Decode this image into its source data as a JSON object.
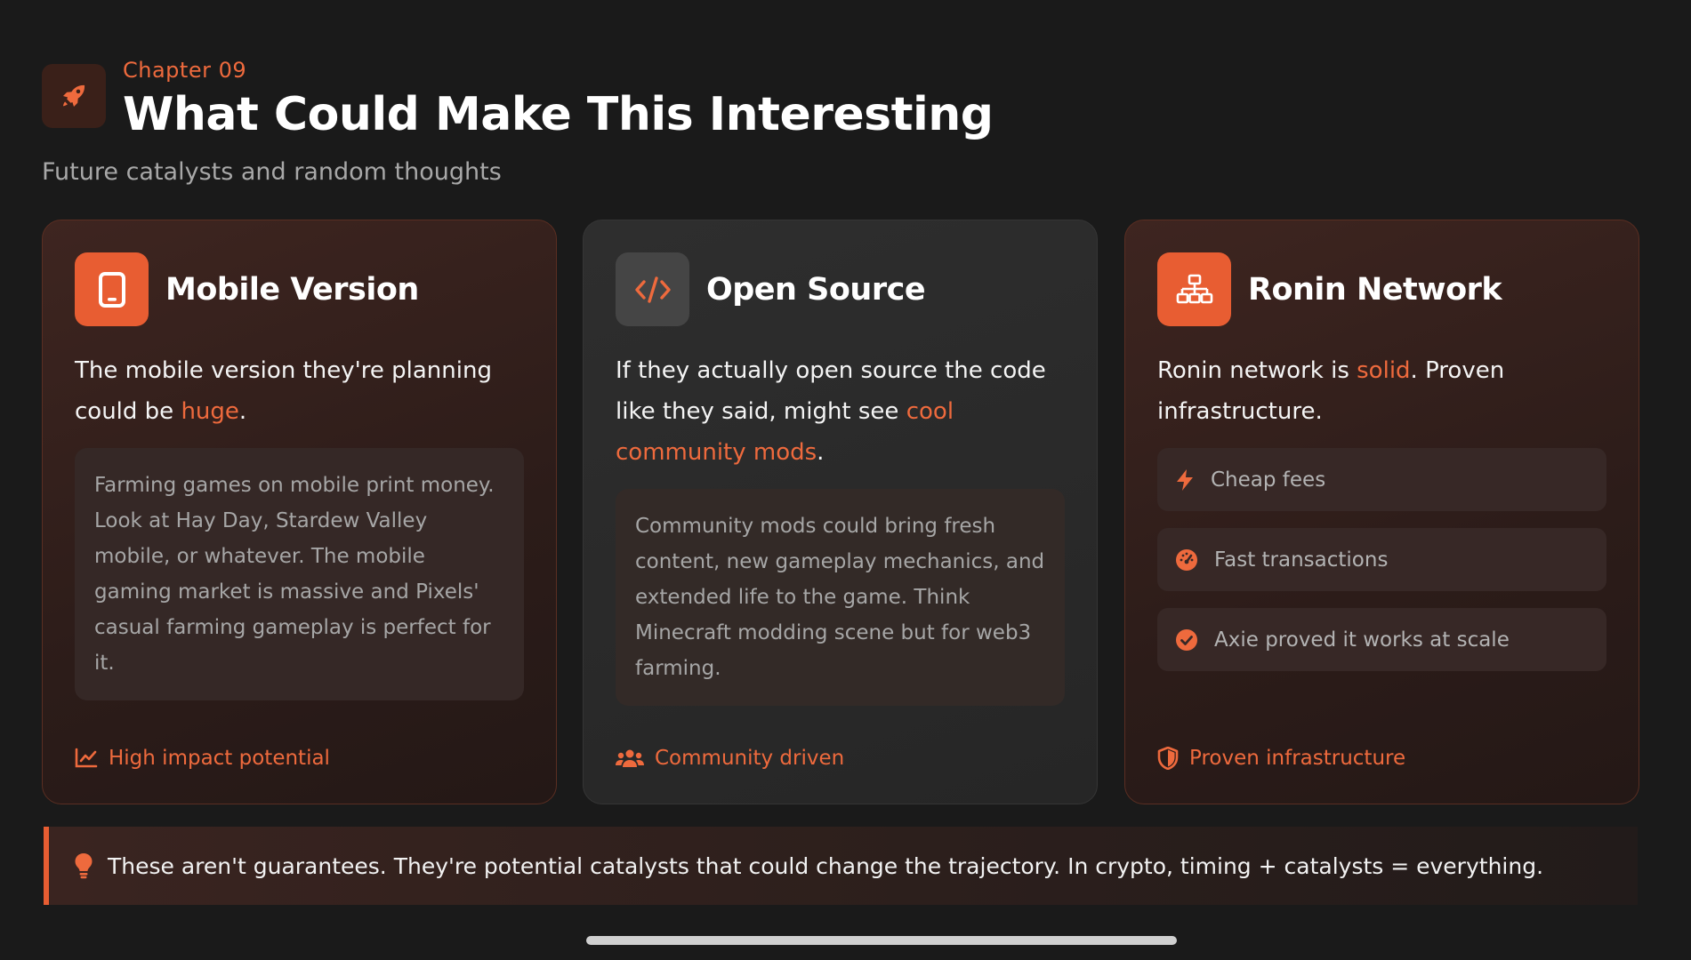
{
  "header": {
    "chapter": "Chapter 09",
    "title": "What Could Make This Interesting",
    "subtitle": "Future catalysts and random thoughts",
    "icon": "rocket-icon"
  },
  "colors": {
    "accent": "#e85d32",
    "accent_text": "#ee6a3d",
    "background": "#1a1a1a"
  },
  "cards": [
    {
      "title": "Mobile Version",
      "icon": "mobile-icon",
      "lead_before": "The mobile version they're planning could be ",
      "lead_highlight": "huge",
      "lead_after": ".",
      "note": "Farming games on mobile print money. Look at Hay Day, Stardew Valley mobile, or whatever. The mobile gaming market is massive and Pixels' casual farming gameplay is perfect for it.",
      "footer": "High impact potential",
      "footer_icon": "chart-line-icon"
    },
    {
      "title": "Open Source",
      "icon": "code-icon",
      "lead_before": "If they actually open source the code like they said, might see ",
      "lead_highlight": "cool community mods",
      "lead_after": ".",
      "note": "Community mods could bring fresh content, new gameplay mechanics, and extended life to the game. Think Minecraft modding scene but for web3 farming.",
      "footer": "Community driven",
      "footer_icon": "users-icon"
    },
    {
      "title": "Ronin Network",
      "icon": "network-icon",
      "lead_before": "Ronin network is ",
      "lead_highlight": "solid",
      "lead_after": ". Proven infrastructure.",
      "features": [
        {
          "label": "Cheap fees",
          "icon": "bolt-icon"
        },
        {
          "label": "Fast transactions",
          "icon": "speedometer-icon"
        },
        {
          "label": "Axie proved it works at scale",
          "icon": "check-circle-icon"
        }
      ],
      "footer": "Proven infrastructure",
      "footer_icon": "shield-icon"
    }
  ],
  "banner": {
    "text": "These aren't guarantees. They're potential catalysts that could change the trajectory. In crypto, timing + catalysts = everything.",
    "icon": "lightbulb-icon"
  }
}
